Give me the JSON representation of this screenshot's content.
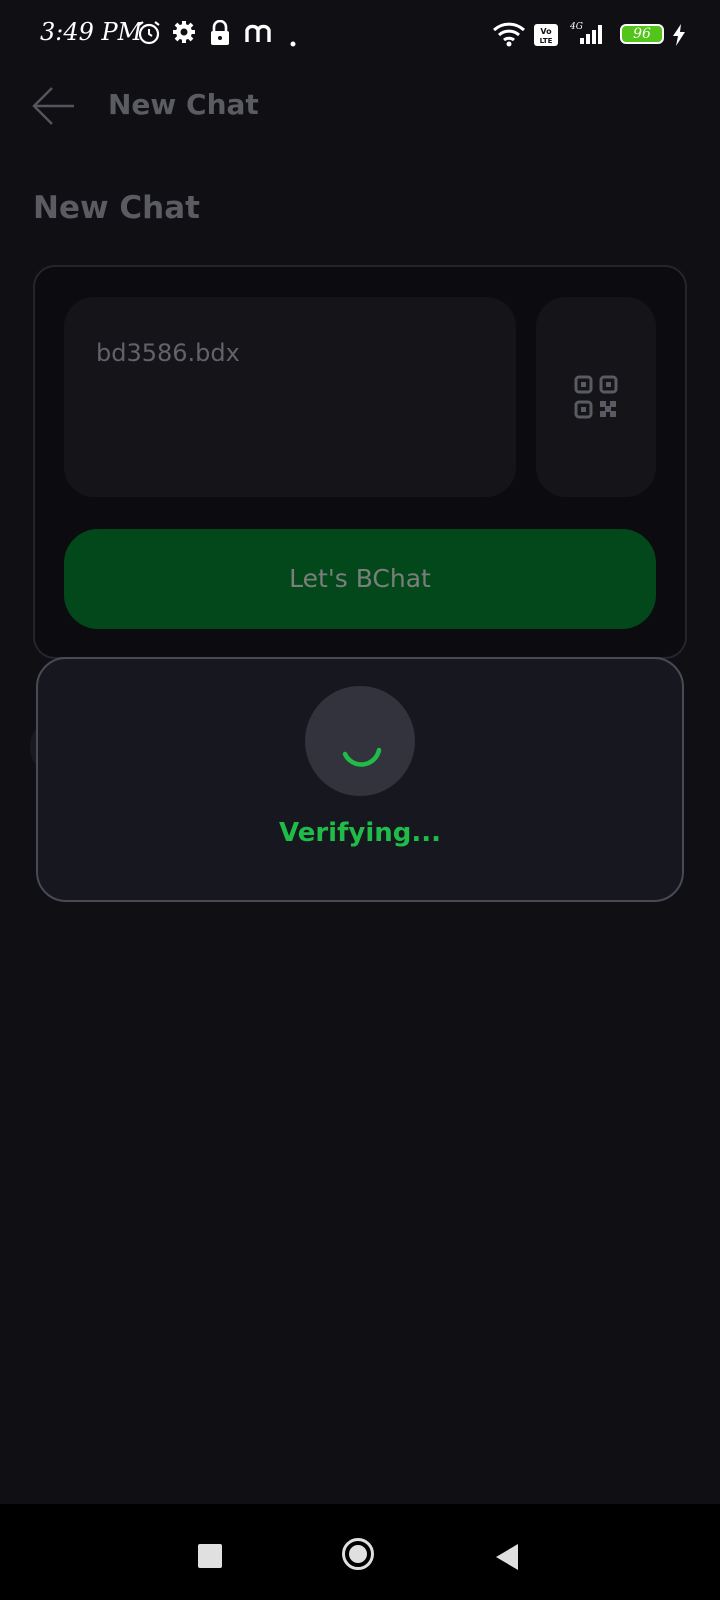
{
  "status_bar": {
    "time": "3:49 PM",
    "battery": "96",
    "icons": [
      "alarm-icon",
      "settings-icon",
      "lock-icon",
      "m-app-icon",
      "dot-icon",
      "wifi-icon",
      "volte-icon",
      "signal-4g-icon",
      "battery-icon",
      "charging-icon"
    ]
  },
  "header": {
    "title": "New Chat",
    "back_icon": "back-arrow-icon"
  },
  "section": {
    "title": "New Chat"
  },
  "form": {
    "address_value": "bd3586.bdx",
    "qr_icon": "qr-code-icon",
    "button_label": "Let's BChat"
  },
  "dialog": {
    "message": "Verifying...",
    "spinner_icon": "loading-spinner-icon"
  },
  "nav_bar": {
    "icons": [
      "recents-icon",
      "home-icon",
      "back-icon"
    ]
  },
  "colors": {
    "background": "#0f0f14",
    "accent_green": "#1fbc47",
    "button_green": "#03481a",
    "muted_text": "#5b5b62"
  }
}
